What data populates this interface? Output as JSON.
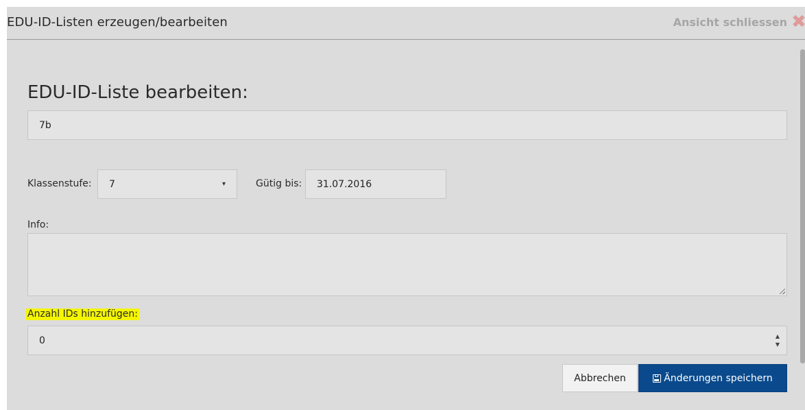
{
  "window": {
    "title": "EDU-ID-Listen erzeugen/bearbeiten",
    "close_label": "Ansicht schliessen",
    "close_icon": "close-x-icon"
  },
  "form": {
    "heading": "EDU-ID-Liste bearbeiten:",
    "name_value": "7b",
    "level_label": "Klassenstufe:",
    "level_value": "7",
    "valid_label": "Gütig bis:",
    "valid_value": "31.07.2016",
    "info_label": "Info:",
    "info_value": "",
    "count_label": "Anzahl IDs hinzufügen:",
    "count_value": "0"
  },
  "buttons": {
    "cancel_label": "Abbrechen",
    "save_label": "Änderungen speichern",
    "save_icon": "floppy-disk-icon"
  },
  "colors": {
    "primary": "#0a4a8c",
    "highlight": "#f5f500",
    "close_icon": "#e09a9a"
  }
}
